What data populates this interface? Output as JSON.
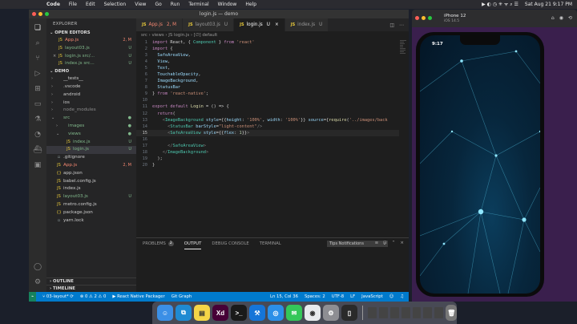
{
  "menubar": {
    "app": "Code",
    "items": [
      "File",
      "Edit",
      "Selection",
      "View",
      "Go",
      "Run",
      "Terminal",
      "Window",
      "Help"
    ],
    "clock": "Sat Aug 21  9:17 PM"
  },
  "window": {
    "title": "login.js — demo"
  },
  "sidebar": {
    "header": "EXPLORER",
    "open_editors_label": "OPEN EDITORS",
    "open_editors": [
      {
        "name": "App.js",
        "status": "2, M",
        "color": "err"
      },
      {
        "name": "layout03.js",
        "status": "U",
        "color": "new"
      },
      {
        "name": "login.js  src/...",
        "status": "U",
        "color": "new",
        "close": "×"
      },
      {
        "name": "index.js  src...",
        "status": "U",
        "color": "new"
      }
    ],
    "project_label": "DEMO",
    "tree": [
      {
        "name": "__tests__",
        "twisty": "›",
        "indent": 1,
        "color": ""
      },
      {
        "name": ".vscode",
        "twisty": "›",
        "indent": 1,
        "color": ""
      },
      {
        "name": "android",
        "twisty": "›",
        "indent": 1,
        "color": ""
      },
      {
        "name": "ios",
        "twisty": "›",
        "indent": 1,
        "color": ""
      },
      {
        "name": "node_modules",
        "twisty": "›",
        "indent": 1,
        "color": "dim"
      },
      {
        "name": "src",
        "twisty": "⌄",
        "indent": 1,
        "color": "new"
      },
      {
        "name": "images",
        "twisty": "›",
        "indent": 2,
        "color": "new"
      },
      {
        "name": "views",
        "twisty": "⌄",
        "indent": 2,
        "color": "new"
      },
      {
        "name": "index.js",
        "status": "U",
        "indent": 3,
        "color": "new"
      },
      {
        "name": "login.js",
        "status": "U",
        "indent": 3,
        "color": "new",
        "selected": true
      },
      {
        "name": ".gitignore",
        "indent": 1,
        "color": ""
      },
      {
        "name": "App.js",
        "status": "2, M",
        "indent": 1,
        "color": "err"
      },
      {
        "name": "app.json",
        "indent": 1,
        "color": ""
      },
      {
        "name": "babel.config.js",
        "indent": 1,
        "color": ""
      },
      {
        "name": "index.js",
        "indent": 1,
        "color": ""
      },
      {
        "name": "layout03.js",
        "status": "U",
        "indent": 1,
        "color": "new"
      },
      {
        "name": "metro.config.js",
        "indent": 1,
        "color": ""
      },
      {
        "name": "package.json",
        "indent": 1,
        "color": ""
      },
      {
        "name": "yarn.lock",
        "indent": 1,
        "color": ""
      }
    ],
    "outline": "OUTLINE",
    "timeline": "TIMELINE"
  },
  "tabs": [
    {
      "name": "App.js",
      "suffix": "2, M",
      "color": "err"
    },
    {
      "name": "layout03.js",
      "suffix": "U",
      "color": ""
    },
    {
      "name": "login.js",
      "suffix": "U",
      "color": "",
      "active": true
    },
    {
      "name": "index.js",
      "suffix": "U",
      "color": ""
    }
  ],
  "breadcrumb": "src  ›  views  ›  JS login.js  ›  [∅] default",
  "panel": {
    "tabs": [
      "PROBLEMS",
      "OUTPUT",
      "DEBUG CONSOLE",
      "TERMINAL"
    ],
    "problems_count": "2",
    "active": "OUTPUT",
    "dropdown": "Tips Notifications"
  },
  "statusbar": {
    "branch": "03-layout*",
    "sync": "⟳",
    "errors": "⊗ 0",
    "warnings": "⚠ 2",
    "info": "⚠ 0",
    "packager": "▶ React Native Packager",
    "git_graph": "Git Graph",
    "cursor": "Ln 15, Col 36",
    "spaces": "Spaces: 2",
    "encoding": "UTF-8",
    "eol": "LF",
    "lang": "JavaScript"
  },
  "simulator": {
    "device": "iPhone 12",
    "os": "iOS 14.5",
    "time": "9:17"
  },
  "dock": {
    "icons": [
      {
        "name": "finder",
        "glyph": "☺",
        "bg": "#3b8fe6"
      },
      {
        "name": "vscode",
        "glyph": "⧉",
        "bg": "#1f8ad2"
      },
      {
        "name": "notes",
        "glyph": "▤",
        "bg": "#f5d547"
      },
      {
        "name": "xd",
        "glyph": "Xd",
        "bg": "#470137"
      },
      {
        "name": "terminal",
        "glyph": ">_",
        "bg": "#1a1a1a"
      },
      {
        "name": "xcode",
        "glyph": "⚒",
        "bg": "#1575d8"
      },
      {
        "name": "safari",
        "glyph": "◎",
        "bg": "#2b8fe8"
      },
      {
        "name": "messages",
        "glyph": "✉",
        "bg": "#34c759"
      },
      {
        "name": "chrome",
        "glyph": "◉",
        "bg": "#e8eaed"
      },
      {
        "name": "settings",
        "glyph": "⚙",
        "bg": "#8e8e93"
      },
      {
        "name": "simulator",
        "glyph": "▯",
        "bg": "#2a2a2a"
      }
    ]
  }
}
